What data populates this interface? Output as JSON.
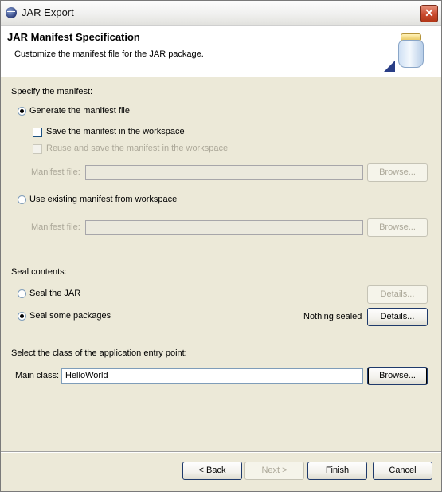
{
  "window": {
    "title": "JAR Export"
  },
  "header": {
    "title": "JAR Manifest Specification",
    "description": "Customize the manifest file for the JAR package."
  },
  "manifest": {
    "section_label": "Specify the manifest:",
    "generate_radio": "Generate the manifest file",
    "save_checkbox": "Save the manifest in the workspace",
    "reuse_checkbox": "Reuse and save the manifest in the workspace",
    "manifest_file_label": "Manifest file:",
    "browse": "Browse...",
    "existing_radio": "Use existing manifest from workspace",
    "manifest_file_label2": "Manifest file:",
    "browse2": "Browse..."
  },
  "seal": {
    "section_label": "Seal contents:",
    "seal_jar_radio": "Seal the JAR",
    "details1": "Details...",
    "seal_some_radio": "Seal some packages",
    "status": "Nothing sealed",
    "details2": "Details..."
  },
  "entry": {
    "section_label": "Select the class of the application entry point:",
    "main_class_label": "Main class:",
    "main_class_value": "HelloWorld",
    "browse": "Browse..."
  },
  "buttons": {
    "back": "< Back",
    "next": "Next >",
    "finish": "Finish",
    "cancel": "Cancel"
  }
}
